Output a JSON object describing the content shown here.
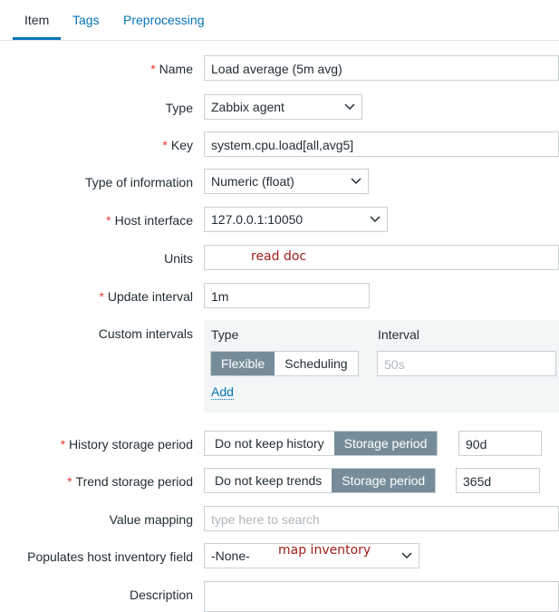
{
  "tabs": [
    {
      "label": "Item",
      "active": true
    },
    {
      "label": "Tags",
      "active": false
    },
    {
      "label": "Preprocessing",
      "active": false
    }
  ],
  "form": {
    "required_mark": "*",
    "name": {
      "label": "Name",
      "value": "Load average (5m avg)"
    },
    "type": {
      "label": "Type",
      "value": "Zabbix agent"
    },
    "key": {
      "label": "Key",
      "value": "system.cpu.load[all,avg5]"
    },
    "type_of_information": {
      "label": "Type of information",
      "value": "Numeric (float)"
    },
    "host_interface": {
      "label": "Host interface",
      "value": "127.0.0.1:10050"
    },
    "units": {
      "label": "Units",
      "value": "",
      "note": "read doc"
    },
    "update_interval": {
      "label": "Update interval",
      "value": "1m"
    },
    "custom_intervals": {
      "label": "Custom intervals",
      "col_type": "Type",
      "col_interval": "Interval",
      "flexible": "Flexible",
      "scheduling": "Scheduling",
      "interval_placeholder": "50s",
      "add": "Add"
    },
    "history_storage": {
      "label": "History storage period",
      "option_off": "Do not keep history",
      "option_on": "Storage period",
      "value": "90d"
    },
    "trend_storage": {
      "label": "Trend storage period",
      "option_off": "Do not keep trends",
      "option_on": "Storage period",
      "value": "365d"
    },
    "value_mapping": {
      "label": "Value mapping",
      "placeholder": "type here to search"
    },
    "inventory_field": {
      "label": "Populates host inventory field",
      "value": "-None-",
      "note": "map inventory"
    },
    "description": {
      "label": "Description",
      "value": ""
    }
  },
  "colors": {
    "accent": "#0275b8",
    "required": "#e33734",
    "segment_active": "#768d99",
    "note": "#a11d1a"
  }
}
